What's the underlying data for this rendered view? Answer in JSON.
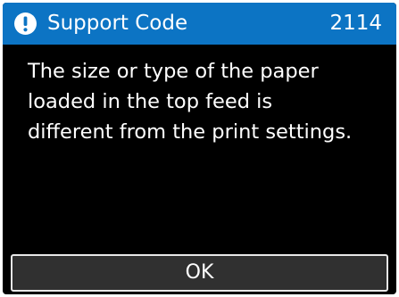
{
  "header": {
    "icon": "alert-circle-icon",
    "title": "Support Code",
    "code": "2114",
    "background_color": "#0c74c4"
  },
  "message": {
    "lines": [
      "The size or type of the paper",
      "loaded in the top feed is",
      "different from the print settings."
    ]
  },
  "buttons": {
    "ok_label": "OK"
  }
}
